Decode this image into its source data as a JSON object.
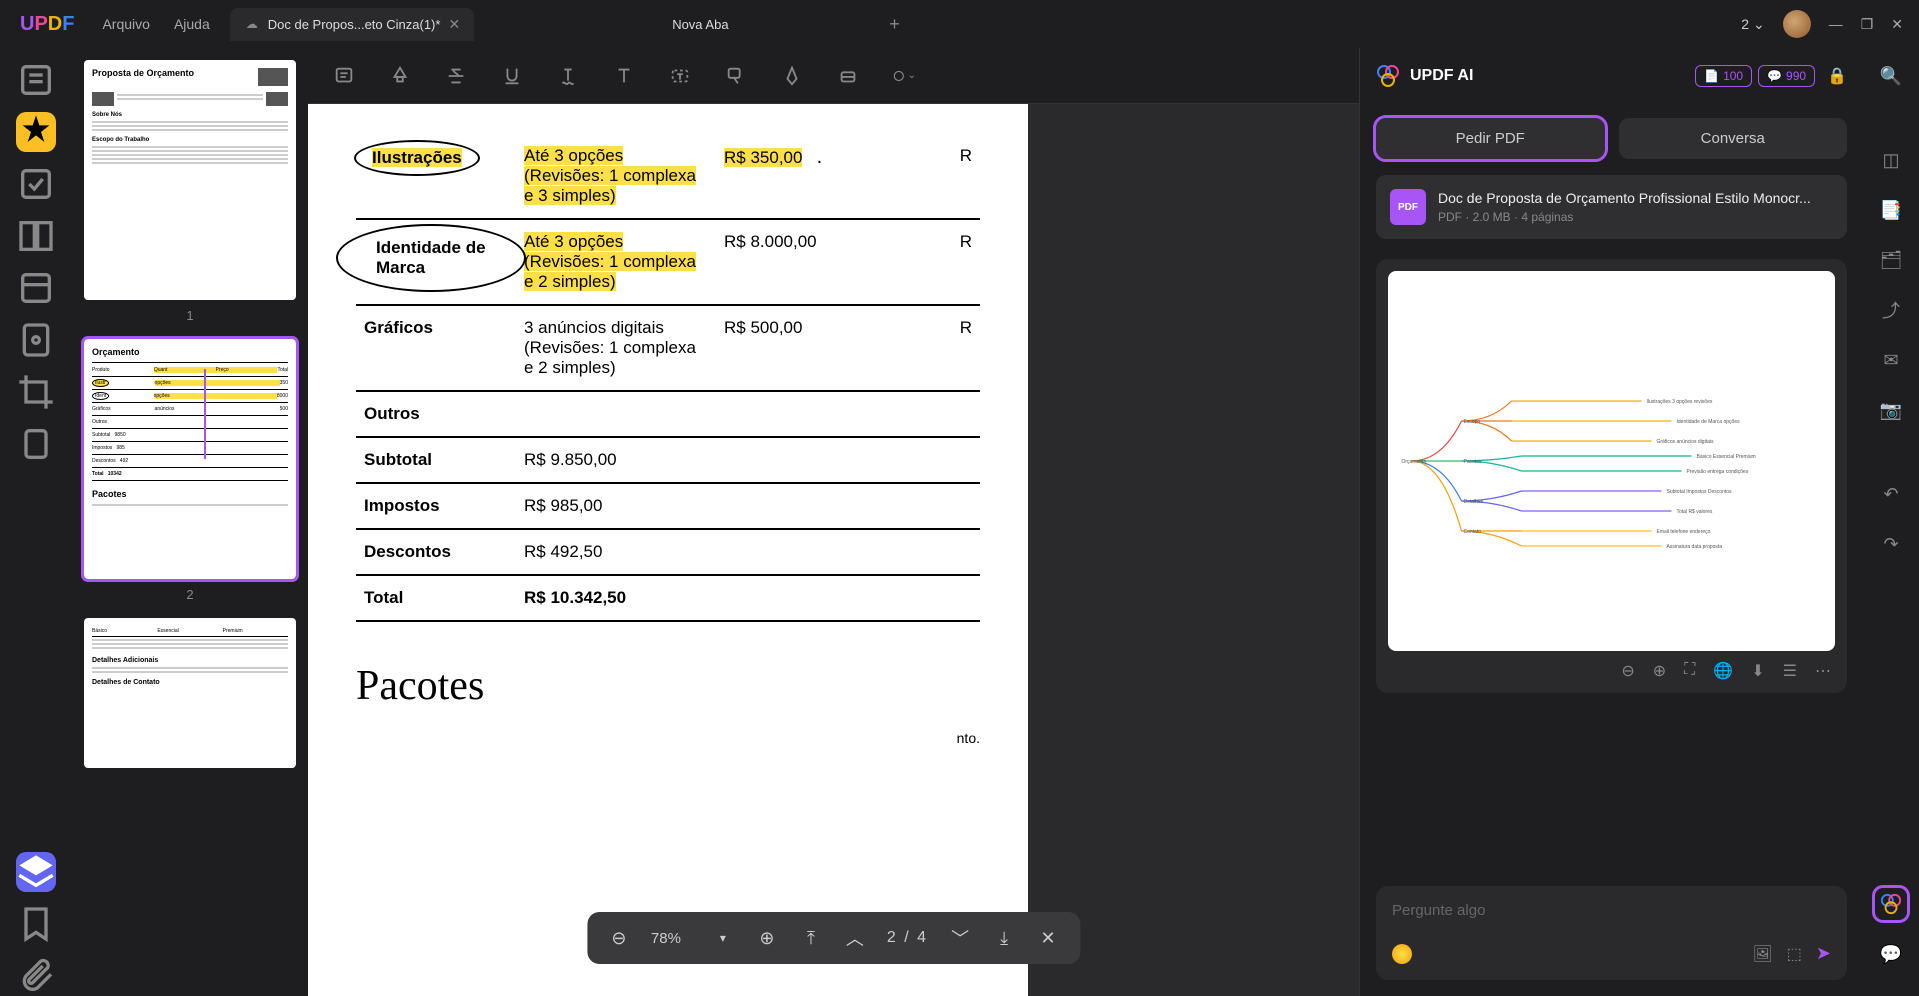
{
  "menubar": {
    "arquivo": "Arquivo",
    "ajuda": "Ajuda"
  },
  "tabs": {
    "active": {
      "title": "Doc de Propos...eto Cinza(1)*"
    },
    "second": {
      "title": "Nova Aba"
    }
  },
  "window_count": "2",
  "thumbnails": {
    "n1": "1",
    "n2": "2"
  },
  "thumb1": {
    "title": "Proposta de Orçamento",
    "h1": "Sobre Nós",
    "h2": "Escopo do Trabalho"
  },
  "thumb2": {
    "title": "Orçamento",
    "h2": "Pacotes"
  },
  "doc": {
    "rows": {
      "ilustracoes": {
        "label": "Ilustrações",
        "desc1": "Até 3 opções",
        "desc2": "(Revisões: 1 complexa",
        "desc3": "e 3 simples)",
        "price": "R$ 350,00",
        "r": "R"
      },
      "identidade": {
        "label1": "Identidade de",
        "label2": "Marca",
        "desc1": "Até 3 opções",
        "desc2": "(Revisões: 1 complexa",
        "desc3": "e 2 simples)",
        "price": "R$ 8.000,00",
        "r": "R"
      },
      "graficos": {
        "label": "Gráficos",
        "desc1": "3 anúncios digitais",
        "desc2": "(Revisões: 1 complexa",
        "desc3": "e 2 simples)",
        "price": "R$ 500,00",
        "r": "R"
      },
      "outros": {
        "label": "Outros"
      },
      "subtotal": {
        "label": "Subtotal",
        "value": "R$ 9.850,00"
      },
      "impostos": {
        "label": "Impostos",
        "value": "R$ 985,00"
      },
      "descontos": {
        "label": "Descontos",
        "value": "R$ 492,50"
      },
      "total": {
        "label": "Total",
        "value": "R$ 10.342,50"
      }
    },
    "pacotes_h": "Pacotes",
    "pacotes_p": "nto."
  },
  "zoom": {
    "pct": "78%",
    "page": "2  /  4"
  },
  "ai": {
    "title": "UPDF AI",
    "badge1": "100",
    "badge2": "990",
    "tab_pedir": "Pedir PDF",
    "tab_conversa": "Conversa",
    "doc_title": "Doc de Proposta de Orçamento Profissional Estilo Monocr...",
    "doc_meta": "PDF · 2.0 MB · 4 páginas",
    "doc_badge": "PDF",
    "input_placeholder": "Pergunte algo"
  }
}
